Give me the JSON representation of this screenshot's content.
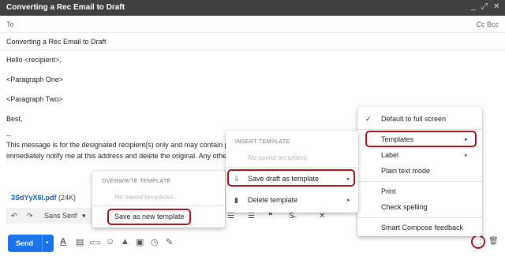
{
  "window": {
    "title": "Converting a Rec Email to Draft",
    "min_glyph": "_",
    "expand_glyph": "⤢",
    "close_glyph": "✕"
  },
  "compose": {
    "to_label": "To",
    "cc_bcc": "Cc Bcc",
    "subject": "Converting a Rec Email to Draft",
    "body_lines": [
      "Hello <recipient>,",
      "<Paragraph One>",
      "<Paragraph Two>",
      "Best,",
      "--",
      "This message is for the designated recipient(s) only and may contain privil",
      "immediately notify me at this address and delete the original. Any other us"
    ],
    "attachment": {
      "name": "3SdYyX6l.pdf",
      "size": "(24K)"
    }
  },
  "format_toolbar": {
    "undo_glyph": "↶",
    "redo_glyph": "↷",
    "font": "Sans Serif",
    "font_caret": "▾",
    "extra_glyphs": [
      "☰",
      "☰",
      "❝",
      "S̶",
      "✕"
    ]
  },
  "bottom_bar": {
    "send_label": "Send",
    "send_caret": "▾",
    "icons": [
      {
        "name": "text-format-icon",
        "glyph": "A"
      },
      {
        "name": "attach-file-icon",
        "glyph": "▤"
      },
      {
        "name": "insert-link-icon",
        "glyph": "⊂⊃"
      },
      {
        "name": "emoji-icon",
        "glyph": "☺"
      },
      {
        "name": "drive-icon",
        "glyph": "▲"
      },
      {
        "name": "photo-icon",
        "glyph": "▣"
      },
      {
        "name": "confidential-icon",
        "glyph": "◷"
      },
      {
        "name": "signature-icon",
        "glyph": "✎"
      }
    ],
    "more_glyph": "⋮",
    "trash_glyph": "🗑"
  },
  "main_menu": {
    "items": {
      "default_full_screen": "Default to full screen",
      "templates": "Templates",
      "label": "Label",
      "plain_text": "Plain text mode",
      "print": "Print",
      "check_spelling": "Check spelling",
      "smart_compose": "Smart Compose feedback"
    },
    "check_glyph": "✓",
    "arrow_glyph": "▸"
  },
  "templates_menu": {
    "insert_header": "INSERT TEMPLATE",
    "no_saved": "No saved templates",
    "save_draft": "Save draft as template",
    "delete_template": "Delete template",
    "save_icon_glyph": "⇩",
    "delete_icon_glyph": "▮",
    "arrow_glyph": "▸"
  },
  "overwrite_menu": {
    "header": "OVERWRITE TEMPLATE",
    "no_saved": "No saved templates",
    "save_new": "Save as new template"
  },
  "highlight_color": "#a1171b"
}
